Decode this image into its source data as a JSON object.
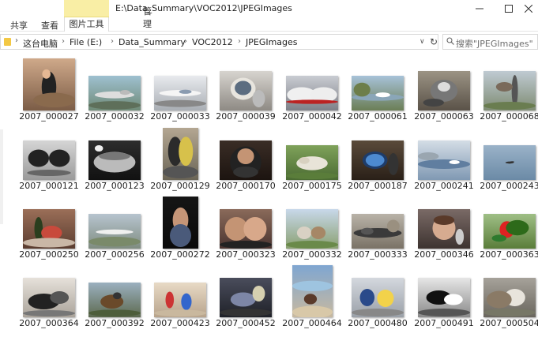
{
  "ribbon": {
    "share": "共享",
    "view": "查看",
    "manage": "管理",
    "picture_tools": "图片工具"
  },
  "window_title": "E:\\Data_Summary\\VOC2012\\JPEGImages",
  "address": {
    "crumbs": [
      "这台电脑",
      "File (E:)",
      "Data_Summary",
      "VOC2012",
      "JPEGImages"
    ]
  },
  "search": {
    "placeholder": "搜索\"JPEGImages\""
  },
  "files": [
    {
      "name": "2007_000027",
      "icon": "photo-person-walking"
    },
    {
      "name": "2007_000032",
      "icon": "photo-airplane-ground"
    },
    {
      "name": "2007_000033",
      "icon": "photo-airliner"
    },
    {
      "name": "2007_000039",
      "icon": "photo-crt-monitor"
    },
    {
      "name": "2007_000042",
      "icon": "photo-train"
    },
    {
      "name": "2007_000061",
      "icon": "photo-boat-river"
    },
    {
      "name": "2007_000063",
      "icon": "photo-dog-on-bike"
    },
    {
      "name": "2007_000068",
      "icon": "photo-bird-pole"
    },
    {
      "name": "2007_000121",
      "icon": "photo-two-monitors"
    },
    {
      "name": "2007_000123",
      "icon": "photo-train-night"
    },
    {
      "name": "2007_000129",
      "icon": "photo-cyclists"
    },
    {
      "name": "2007_000170",
      "icon": "photo-man-smiling"
    },
    {
      "name": "2007_000175",
      "icon": "photo-sheep-grass"
    },
    {
      "name": "2007_000187",
      "icon": "photo-tv-monitor"
    },
    {
      "name": "2007_000241",
      "icon": "photo-boats-lake"
    },
    {
      "name": "2007_000243",
      "icon": "photo-plane-sky"
    },
    {
      "name": "2007_000250",
      "icon": "photo-bottles-table"
    },
    {
      "name": "2007_000256",
      "icon": "photo-airplane-runway"
    },
    {
      "name": "2007_000272",
      "icon": "photo-person-dark"
    },
    {
      "name": "2007_000323",
      "icon": "photo-two-people"
    },
    {
      "name": "2007_000332",
      "icon": "photo-horses-field"
    },
    {
      "name": "2007_000333",
      "icon": "photo-freight-train"
    },
    {
      "name": "2007_000346",
      "icon": "photo-woman-bottle"
    },
    {
      "name": "2007_000363",
      "icon": "photo-parrot"
    },
    {
      "name": "2007_000364",
      "icon": "photo-motorbikes"
    },
    {
      "name": "2007_000392",
      "icon": "photo-horse-rider"
    },
    {
      "name": "2007_000423",
      "icon": "photo-kids-room"
    },
    {
      "name": "2007_000452",
      "icon": "photo-living-room"
    },
    {
      "name": "2007_000464",
      "icon": "photo-cow-beach"
    },
    {
      "name": "2007_000480",
      "icon": "photo-kids-bikes"
    },
    {
      "name": "2007_000491",
      "icon": "photo-cows-bw"
    },
    {
      "name": "2007_000504",
      "icon": "photo-cat-clutter"
    }
  ]
}
